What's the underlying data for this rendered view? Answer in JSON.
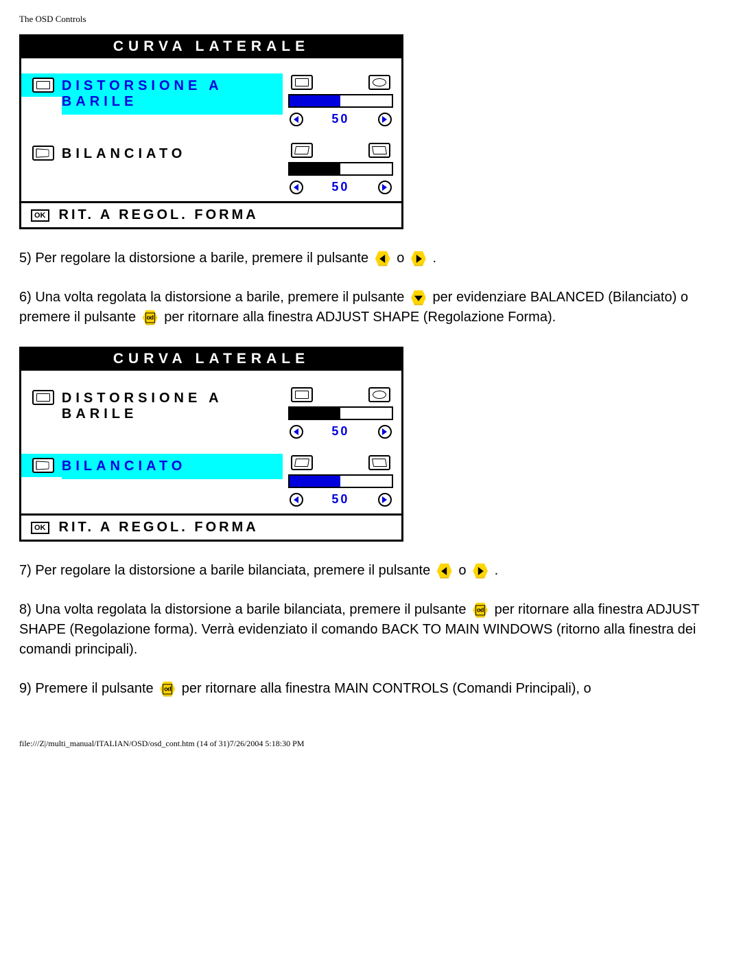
{
  "header": "The OSD Controls",
  "panel1": {
    "title": "CURVA LATERALE",
    "row1_label": "DISTORSIONE A BARILE",
    "row1_value": "50",
    "row2_label": "BILANCIATO",
    "row2_value": "50",
    "footer": "RIT. A REGOL. FORMA",
    "ok": "OK"
  },
  "step5_a": "5) Per regolare la distorsione a barile, premere il pulsante ",
  "step5_o": " o ",
  "step5_end": " .",
  "step6_a": "6) Una volta regolata la distorsione a barile, premere il pulsante ",
  "step6_b": " per evidenziare BALANCED (Bilanciato) o premere il pulsante ",
  "step6_c": " per ritornare alla finestra ADJUST SHAPE (Regolazione Forma).",
  "panel2": {
    "title": "CURVA LATERALE",
    "row1_label": "DISTORSIONE A BARILE",
    "row1_value": "50",
    "row2_label": "BILANCIATO",
    "row2_value": "50",
    "footer": "RIT. A REGOL. FORMA",
    "ok": "OK"
  },
  "step7_a": "7) Per regolare la distorsione a barile bilanciata, premere il pulsante ",
  "step7_o": " o ",
  "step7_end": "  .",
  "step8_a": "8) Una volta regolata la distorsione a barile bilanciata, premere il pulsante ",
  "step8_b": " per ritornare alla finestra ADJUST SHAPE (Regolazione forma). Verrà evidenziato il comando BACK TO MAIN WINDOWS (ritorno alla finestra dei comandi principali).",
  "step9_a": "9) Premere il pulsante ",
  "step9_b": " per ritornare alla finestra MAIN CONTROLS (Comandi Principali), o",
  "footer": "file:///Z|/multi_manual/ITALIAN/OSD/osd_cont.htm (14 of 31)7/26/2004 5:18:30 PM"
}
